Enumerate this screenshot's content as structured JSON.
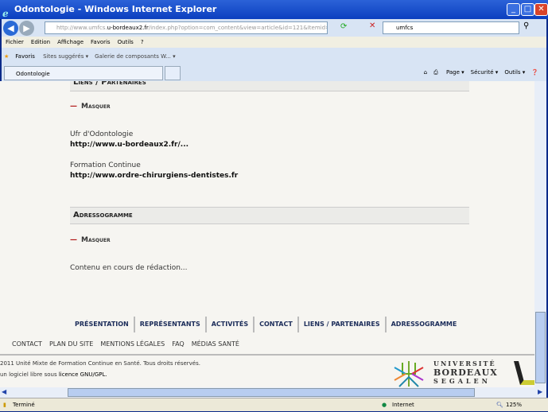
{
  "window": {
    "title": "Odontologie - Windows Internet Explorer"
  },
  "toolbar": {
    "url_prefix": "http://www.umfcs.",
    "url_domain": "u-bordeaux2.fr",
    "url_path": "/index.php?option=com_content&view=article&id=121&Itemid=122",
    "search_value": "umfcs"
  },
  "menu": [
    "Fichier",
    "Edition",
    "Affichage",
    "Favoris",
    "Outils",
    "?"
  ],
  "favorites": {
    "label": "Favoris",
    "items": [
      "Sites suggérés ▾",
      "Galerie de composants W... ▾"
    ]
  },
  "tab": {
    "title": "Odontologie"
  },
  "commands": [
    "Page ▾",
    "Sécurité ▾",
    "Outils ▾"
  ],
  "content": {
    "section1": {
      "title": "Liens / Partenaires",
      "toggle": "Masquer",
      "links": [
        {
          "label": "Ufr d'Odontologie",
          "url": "http://www.u-bordeaux2.fr/..."
        },
        {
          "label": "Formation Continue",
          "url": "http://www.ordre-chirurgiens-dentistes.fr"
        }
      ]
    },
    "section2": {
      "title": "Adressogramme",
      "toggle": "Masquer",
      "text": "Contenu en cours de rédaction..."
    }
  },
  "main_nav": [
    "PRÉSENTATION",
    "REPRÉSENTANTS",
    "ACTIVITÉS",
    "CONTACT",
    "LIENS / PARTENAIRES",
    "ADRESSOGRAMME"
  ],
  "sub_nav": [
    "CONTACT",
    "PLAN DU SITE",
    "MENTIONS LÉGALES",
    "FAQ",
    "MÉDIAS SANTÉ"
  ],
  "footer": {
    "copyright": "2011 Unité Mixte de Formation Continue en Santé. Tous droits réservés.",
    "license_prefix": "un logiciel libre sous ",
    "license_link": "licence GNU/GPL."
  },
  "logo": {
    "line1": "UNIVERSITÉ",
    "line2": "BORDEAUX",
    "line3": "SEGALEN"
  },
  "status": {
    "text": "Terminé",
    "zone": "Internet",
    "zoom": "125%"
  }
}
